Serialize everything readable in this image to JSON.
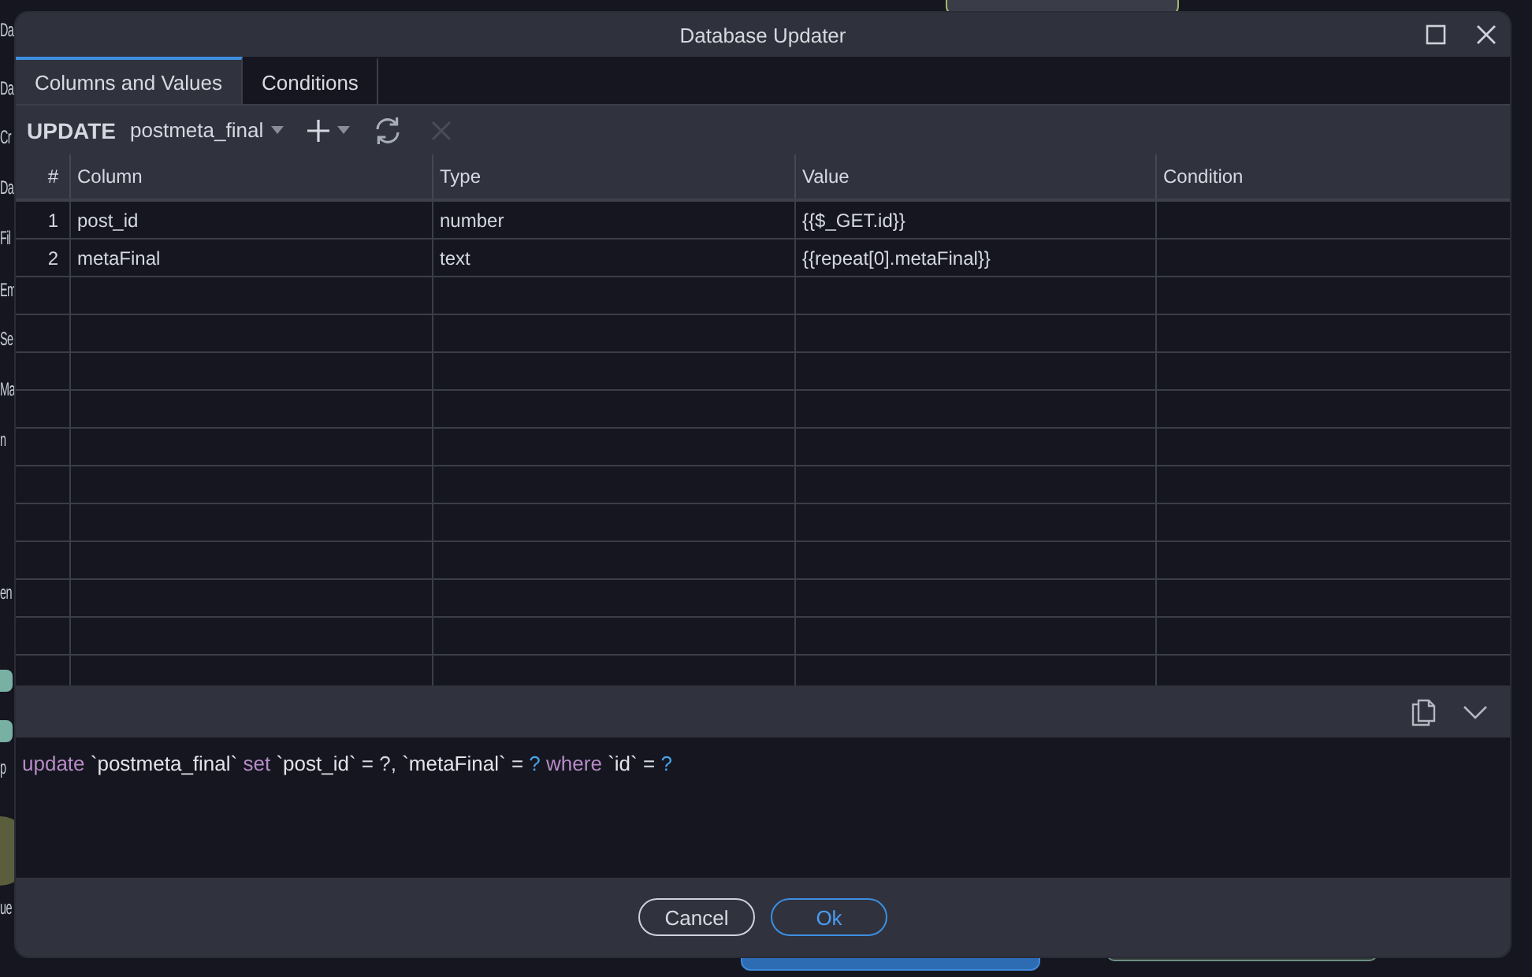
{
  "background": {
    "fragments": [
      "Da",
      "Da",
      "Cr",
      "Da",
      "Fil",
      "Em",
      "Se",
      "Ma",
      "n",
      "en",
      "p",
      "ue"
    ]
  },
  "window": {
    "title": "Database Updater"
  },
  "tabs": [
    {
      "label": "Columns and Values",
      "selected": true
    },
    {
      "label": "Conditions",
      "selected": false
    }
  ],
  "toolbar": {
    "keyword": "UPDATE",
    "table": "postmeta_final",
    "delete_disabled": true
  },
  "table": {
    "columns": [
      "#",
      "Column",
      "Type",
      "Value",
      "Condition"
    ],
    "rows": [
      {
        "cells": [
          "1",
          "post_id",
          "number",
          "{{$_GET.id}}",
          ""
        ]
      },
      {
        "cells": [
          "2",
          "metaFinal",
          "text",
          "{{repeat[0].metaFinal}}",
          ""
        ]
      }
    ]
  },
  "sql": [
    {
      "kind": "keyword",
      "text": "update"
    },
    {
      "kind": "identifier",
      "text": "`postmeta_final`"
    },
    {
      "kind": "keyword",
      "text": "set"
    },
    {
      "kind": "identifier",
      "text": "`post_id`"
    },
    {
      "kind": "plain",
      "text": "= ?,"
    },
    {
      "kind": "identifier",
      "text": "`metaFinal`"
    },
    {
      "kind": "plain",
      "text": "="
    },
    {
      "kind": "param",
      "text": "?"
    },
    {
      "kind": "keyword",
      "text": "where"
    },
    {
      "kind": "identifier",
      "text": "`id`"
    },
    {
      "kind": "plain",
      "text": "="
    },
    {
      "kind": "param",
      "text": "?"
    }
  ],
  "buttons": [
    {
      "label": "Cancel",
      "primary": false
    },
    {
      "label": "Ok",
      "primary": true
    }
  ]
}
